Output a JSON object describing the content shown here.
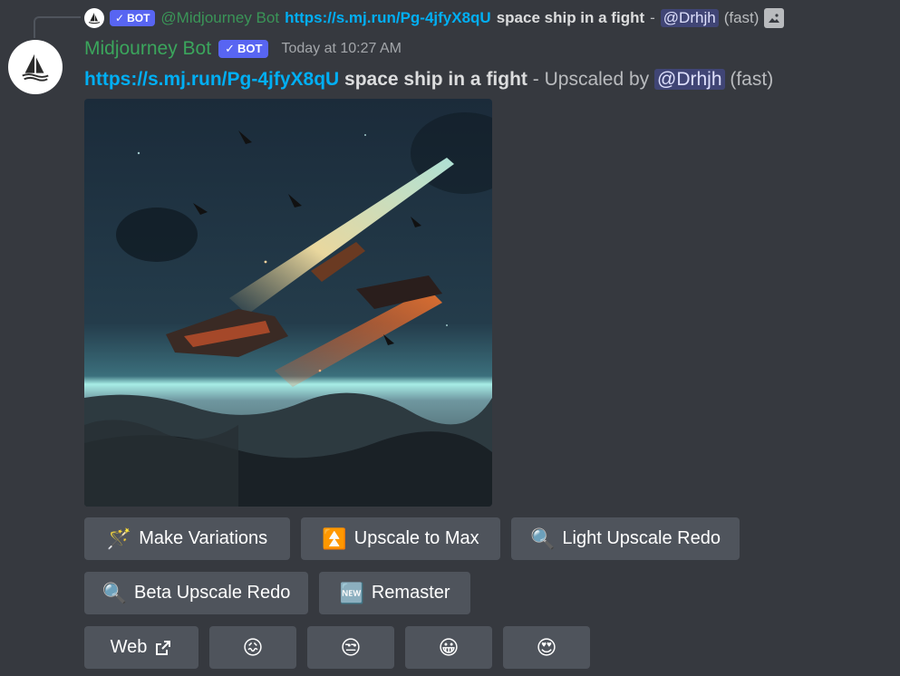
{
  "reply": {
    "bot_tag": "BOT",
    "author": "@Midjourney Bot",
    "link": "https://s.mj.run/Pg-4jfyX8qU",
    "prompt": "space ship in a fight",
    "separator": "-",
    "mention": "@Drhjh",
    "speed": "(fast)",
    "attachment_icon": "image-icon"
  },
  "message": {
    "username": "Midjourney Bot",
    "bot_tag": "BOT",
    "timestamp": "Today at 10:27 AM",
    "link": "https://s.mj.run/Pg-4jfyX8qU",
    "prompt": "space ship in a fight",
    "upscaled_by": "- Upscaled by",
    "mention": "@Drhjh",
    "speed": "(fast)"
  },
  "buttons": {
    "make_variations": {
      "icon": "🪄",
      "label": "Make Variations"
    },
    "upscale_max": {
      "icon": "⏫",
      "label": "Upscale to Max"
    },
    "light_redo": {
      "icon": "🔍",
      "label": "Light Upscale Redo"
    },
    "beta_redo": {
      "icon": "🔍",
      "label": "Beta Upscale Redo"
    },
    "remaster": {
      "icon": "🆕",
      "label": "Remaster"
    },
    "web": {
      "label": "Web",
      "icon": "external-link-icon"
    },
    "reactions": [
      "😖",
      "😒",
      "😀",
      "😍"
    ]
  },
  "colors": {
    "background": "#36393f",
    "button": "#4f545c",
    "link": "#00aff4",
    "username": "#3ba55c",
    "bot_tag": "#5865f2"
  }
}
